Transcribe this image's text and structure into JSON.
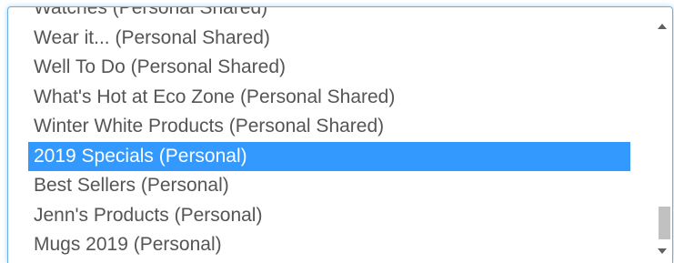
{
  "listbox": {
    "selected_index": 5,
    "scroll_position": 0.92,
    "items": [
      {
        "label": "Watches (Personal Shared)"
      },
      {
        "label": "Wear it... (Personal Shared)"
      },
      {
        "label": "Well To Do (Personal Shared)"
      },
      {
        "label": "What's Hot at Eco Zone (Personal Shared)"
      },
      {
        "label": "Winter White Products (Personal Shared)"
      },
      {
        "label": "2019 Specials (Personal)"
      },
      {
        "label": "Best Sellers (Personal)"
      },
      {
        "label": "Jenn's Products (Personal)"
      },
      {
        "label": "Mugs 2019 (Personal)"
      }
    ]
  },
  "colors": {
    "selected_background": "#3399ff",
    "selected_text": "#ffffff",
    "text": "#555555",
    "focus_border": "#66afe9"
  }
}
